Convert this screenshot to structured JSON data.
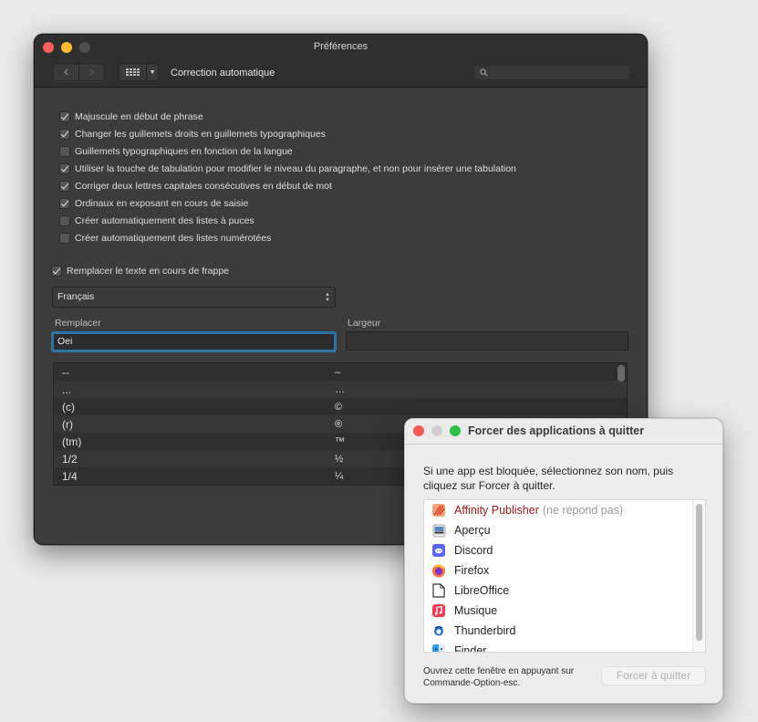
{
  "preferences": {
    "title": "Préférences",
    "section": "Correction automatique",
    "search_placeholder": "",
    "options": [
      {
        "label": "Majuscule en début de phrase",
        "checked": true
      },
      {
        "label": "Changer les guillemets droits en guillemets typographiques",
        "checked": true
      },
      {
        "label": "Guillemets typographiques en fonction de la langue",
        "checked": false
      },
      {
        "label": "Utiliser la touche de tabulation pour modifier le niveau du paragraphe, et non pour insérer une tabulation",
        "checked": true
      },
      {
        "label": "Corriger deux lettres capitales consécutives en début de mot",
        "checked": true
      },
      {
        "label": "Ordinaux en exposant en cours de saisie",
        "checked": true
      },
      {
        "label": "Créer automatiquement des listes à puces",
        "checked": false
      },
      {
        "label": "Créer automatiquement des listes numérotées",
        "checked": false
      }
    ],
    "replace_while_typing": {
      "label": "Remplacer le texte en cours de frappe",
      "checked": true
    },
    "language": "Français",
    "replace_label": "Remplacer",
    "replace_value": "Oei",
    "width_label": "Largeur",
    "width_value": "",
    "replacements": [
      {
        "from": "--",
        "to": "–"
      },
      {
        "from": "...",
        "to": "…"
      },
      {
        "from": "(c)",
        "to": "©"
      },
      {
        "from": "(r)",
        "to": "®"
      },
      {
        "from": "(tm)",
        "to": "™"
      },
      {
        "from": "1/2",
        "to": "½"
      },
      {
        "from": "1/4",
        "to": "¼"
      }
    ]
  },
  "force_quit": {
    "title": "Forcer des applications à quitter",
    "message": "Si une app est bloquée, sélectionnez son nom, puis cliquez sur Forcer à quitter.",
    "apps": [
      {
        "name": "Affinity Publisher",
        "status": "(ne répond pas)",
        "icon": "affinity-publisher-icon",
        "color": "#e8673f"
      },
      {
        "name": "Aperçu",
        "status": "",
        "icon": "preview-icon",
        "color": "#5a87c5"
      },
      {
        "name": "Discord",
        "status": "",
        "icon": "discord-icon",
        "color": "#5865f2"
      },
      {
        "name": "Firefox",
        "status": "",
        "icon": "firefox-icon",
        "color": "#ff7139"
      },
      {
        "name": "LibreOffice",
        "status": "",
        "icon": "libreoffice-icon",
        "color": "#333333"
      },
      {
        "name": "Musique",
        "status": "",
        "icon": "music-icon",
        "color": "#fa3c53"
      },
      {
        "name": "Thunderbird",
        "status": "",
        "icon": "thunderbird-icon",
        "color": "#1f6fd1"
      },
      {
        "name": "Finder",
        "status": "",
        "icon": "finder-icon",
        "color": "#2a9cf4"
      }
    ],
    "footer": "Ouvrez cette fenêtre en appuyant sur Commande-Option-esc.",
    "button": "Forcer à quitter"
  }
}
